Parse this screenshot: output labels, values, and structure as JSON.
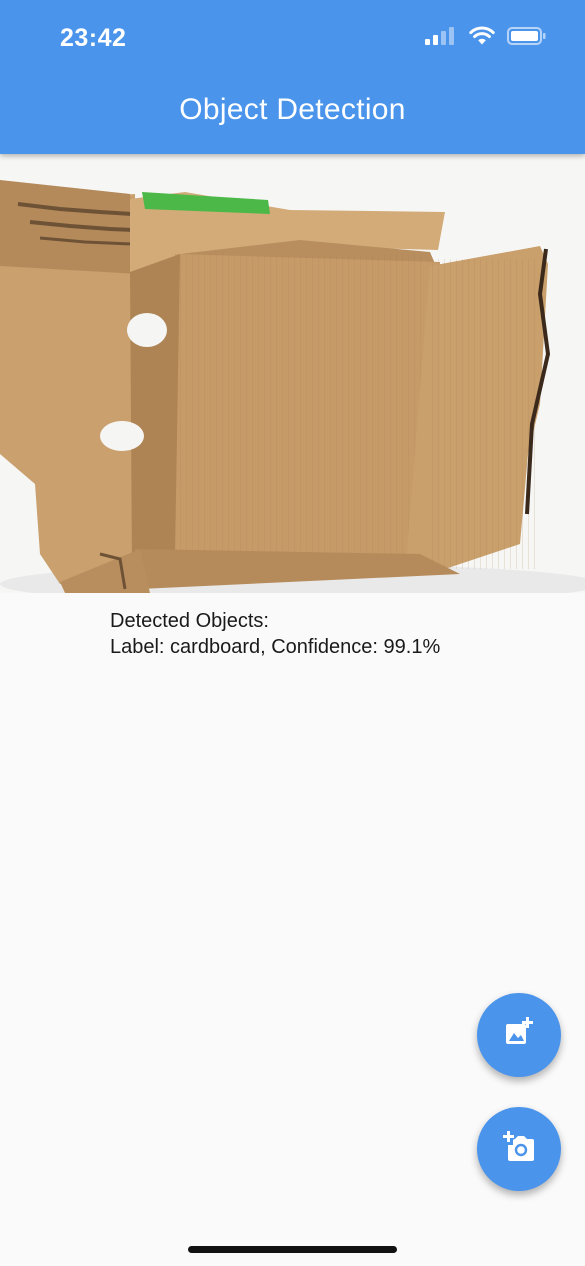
{
  "status_bar": {
    "time": "23:42"
  },
  "app_bar": {
    "title": "Object Detection",
    "color": "#4A94EC"
  },
  "image": {
    "icon": "cardboard-box-photo"
  },
  "results": {
    "heading": "Detected Objects:",
    "items": [
      "Label: cardboard, Confidence: 99.1%"
    ]
  },
  "actions": {
    "gallery_icon": "add-photo-icon",
    "camera_icon": "add-camera-icon"
  }
}
